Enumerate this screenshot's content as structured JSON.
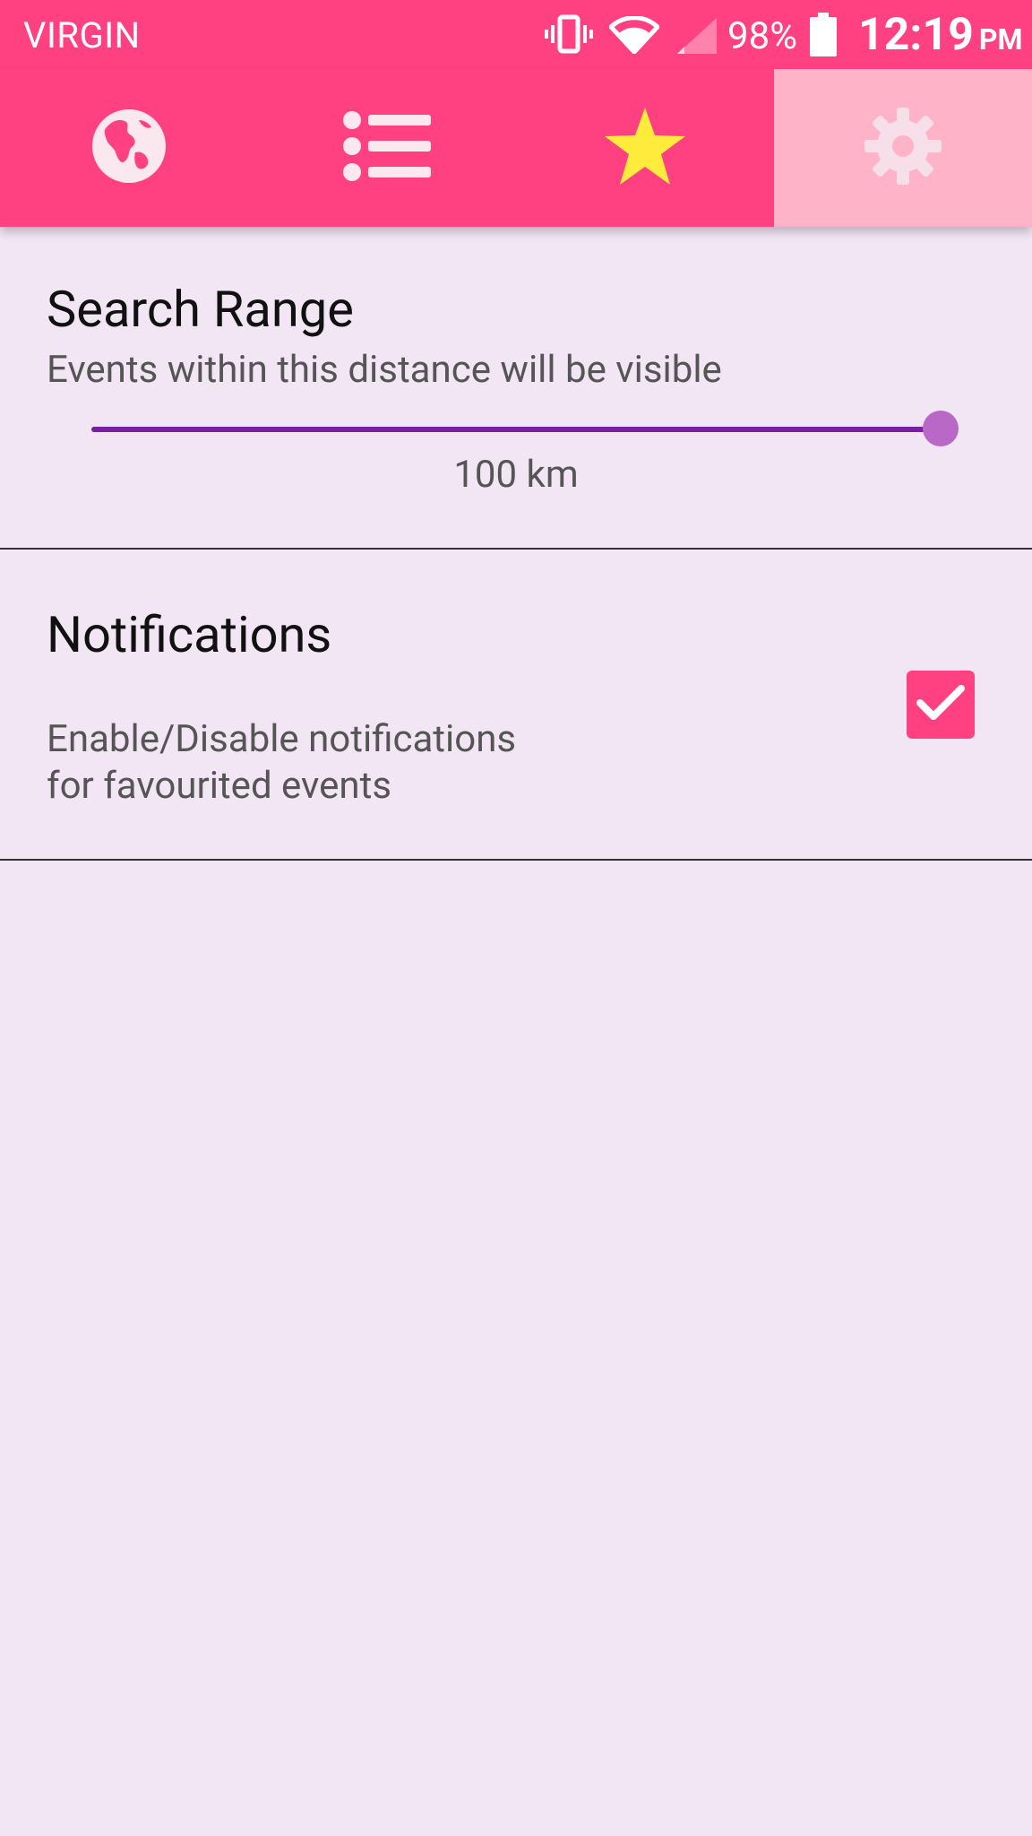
{
  "status_bar": {
    "carrier": "VIRGIN",
    "battery_percent": "98%",
    "time": "12:19",
    "ampm": "PM",
    "icons": [
      "vibrate-icon",
      "wifi-icon",
      "cell-signal-icon",
      "battery-icon"
    ]
  },
  "tabs": [
    {
      "name": "map",
      "icon": "globe-icon",
      "active": false
    },
    {
      "name": "list",
      "icon": "list-icon",
      "active": false
    },
    {
      "name": "favourites",
      "icon": "star-icon",
      "active": false
    },
    {
      "name": "settings",
      "icon": "gear-icon",
      "active": true
    }
  ],
  "colors": {
    "primary": "#ff4081",
    "active_tab": "#ffb3c8",
    "star": "#ffeb3b",
    "background": "#f2e6f4",
    "slider_fill": "#7b1fa2",
    "slider_thumb": "#ba68c8"
  },
  "search_range": {
    "title": "Search Range",
    "description": "Events within this distance will be visible",
    "value_label": "100 km",
    "slider_fraction": 1.0
  },
  "notifications": {
    "title": "Notifications",
    "description_line1": "Enable/Disable notifications",
    "description_line2": "for favourited events",
    "checked": true
  }
}
